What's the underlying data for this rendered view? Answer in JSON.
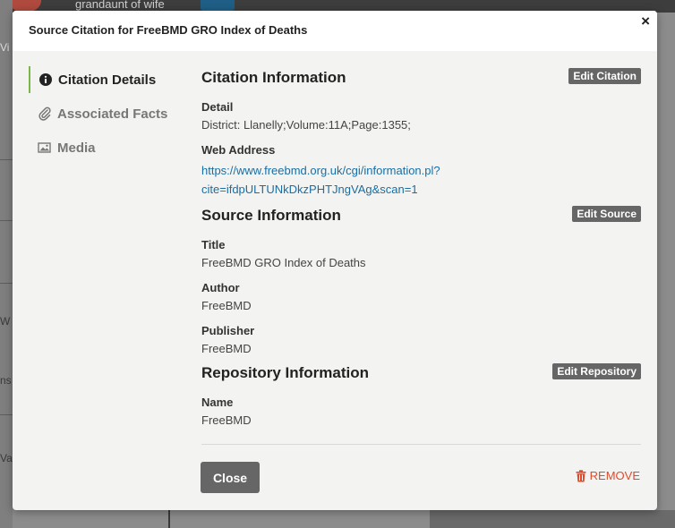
{
  "background": {
    "header_text": "grandaunt of wife",
    "fragments": [
      "Vi",
      "W",
      "ns",
      "Val"
    ]
  },
  "modal": {
    "title": "Source Citation for FreeBMD GRO Index of Deaths",
    "close_icon": "×"
  },
  "nav": {
    "items": [
      {
        "label": "Citation Details",
        "icon": "info-icon"
      },
      {
        "label": "Associated Facts",
        "icon": "paperclip-icon"
      },
      {
        "label": "Media",
        "icon": "photo-icon"
      }
    ]
  },
  "citation": {
    "heading": "Citation Information",
    "edit_label": "Edit Citation",
    "detail_label": "Detail",
    "detail_value": "District: Llanelly;Volume:11A;Page:1355;",
    "web_label": "Web Address",
    "web_value_line1": "https://www.freebmd.org.uk/cgi/information.pl?",
    "web_value_line2": "cite=ifdpULTUNkDkzPHTJngVAg&scan=1"
  },
  "source": {
    "heading": "Source Information",
    "edit_label": "Edit Source",
    "title_label": "Title",
    "title_value": "FreeBMD GRO Index of Deaths",
    "author_label": "Author",
    "author_value": "FreeBMD",
    "publisher_label": "Publisher",
    "publisher_value": "FreeBMD"
  },
  "repository": {
    "heading": "Repository Information",
    "edit_label": "Edit Repository",
    "name_label": "Name",
    "name_value": "FreeBMD"
  },
  "footer": {
    "close_label": "Close",
    "remove_label": "REMOVE"
  },
  "colors": {
    "accent": "#7ab648",
    "link": "#1a6ea4",
    "danger": "#e04a2c"
  }
}
